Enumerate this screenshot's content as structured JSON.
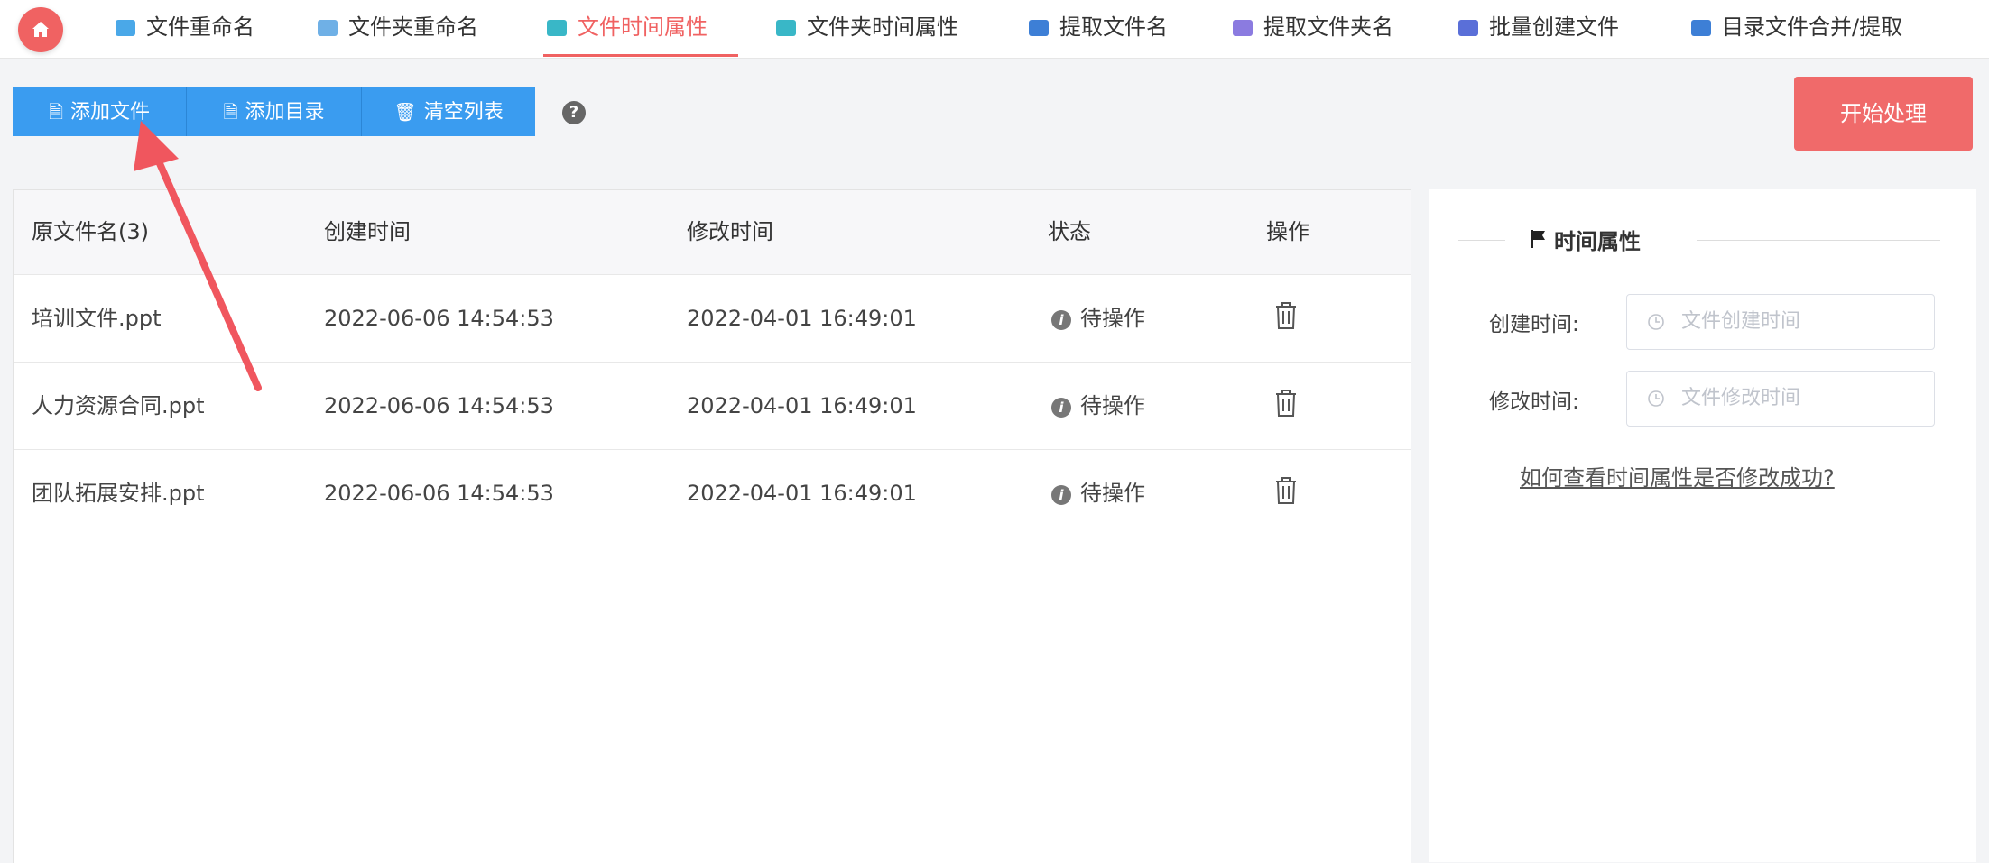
{
  "nav": {
    "tabs": [
      {
        "label": "文件重命名",
        "icon": "file-rename-icon",
        "color": "#4aa8e8"
      },
      {
        "label": "文件夹重命名",
        "icon": "folder-rename-icon",
        "color": "#6fb0e6"
      },
      {
        "label": "文件时间属性",
        "icon": "file-time-icon",
        "color": "#39b7c7",
        "active": true
      },
      {
        "label": "文件夹时间属性",
        "icon": "folder-time-icon",
        "color": "#39b7c7"
      },
      {
        "label": "提取文件名",
        "icon": "extract-filename-icon",
        "color": "#3d7fd6"
      },
      {
        "label": "提取文件夹名",
        "icon": "extract-foldername-icon",
        "color": "#8b7be0"
      },
      {
        "label": "批量创建文件",
        "icon": "batch-create-icon",
        "color": "#5a6fd8"
      },
      {
        "label": "目录文件合并/提取",
        "icon": "merge-extract-icon",
        "color": "#3d7fd6"
      }
    ],
    "accent": "#f06262"
  },
  "toolbar": {
    "add_file": "添加文件",
    "add_dir": "添加目录",
    "clear_list": "清空列表",
    "start": "开始处理",
    "help_glyph": "?"
  },
  "table": {
    "headers": {
      "name": "原文件名(3)",
      "created": "创建时间",
      "modified": "修改时间",
      "status": "状态",
      "action": "操作"
    },
    "rows": [
      {
        "name": "培训文件.ppt",
        "created": "2022-06-06 14:54:53",
        "modified": "2022-04-01 16:49:01",
        "status": "待操作"
      },
      {
        "name": "人力资源合同.ppt",
        "created": "2022-06-06 14:54:53",
        "modified": "2022-04-01 16:49:01",
        "status": "待操作"
      },
      {
        "name": "团队拓展安排.ppt",
        "created": "2022-06-06 14:54:53",
        "modified": "2022-04-01 16:49:01",
        "status": "待操作"
      }
    ]
  },
  "side": {
    "section_title": "时间属性",
    "created_label": "创建时间:",
    "created_placeholder": "文件创建时间",
    "modified_label": "修改时间:",
    "modified_placeholder": "文件修改时间",
    "help_link": "如何查看时间属性是否修改成功?"
  },
  "annotation": {
    "arrow_color": "#f0565e"
  }
}
